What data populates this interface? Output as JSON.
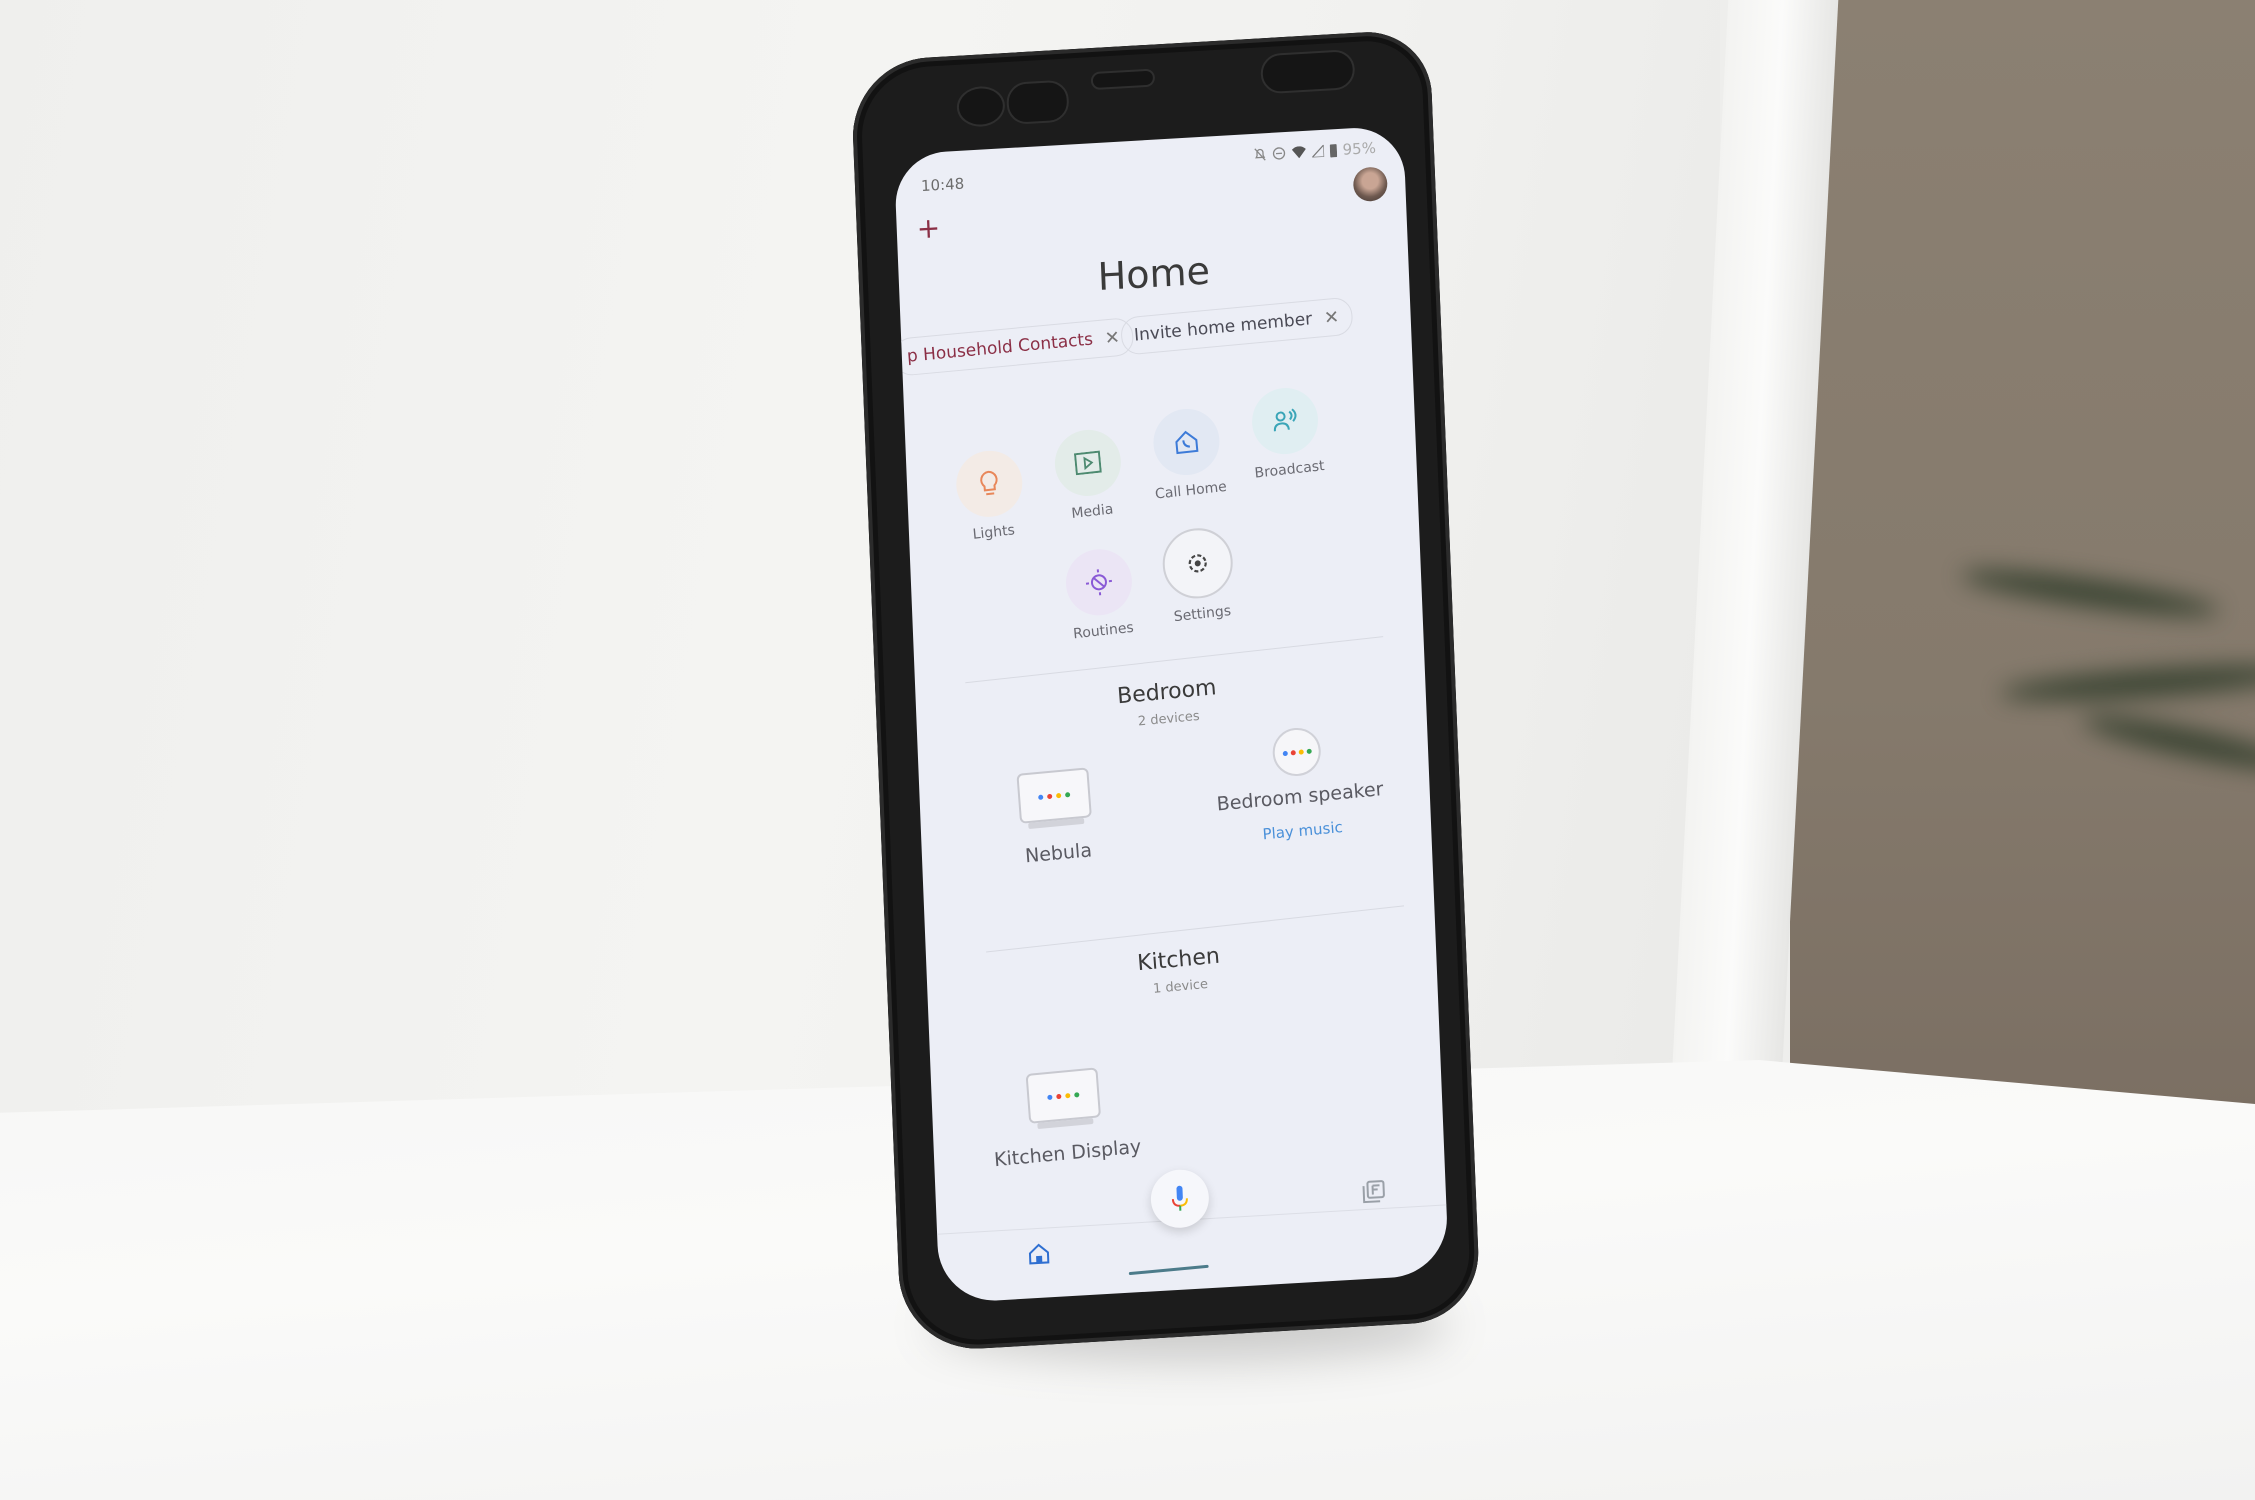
{
  "status_bar": {
    "time": "10:48",
    "icons": [
      "bell-off-icon",
      "do-not-disturb-icon",
      "wifi-icon",
      "signal-icon",
      "battery-icon"
    ],
    "battery": "95%"
  },
  "header": {
    "add_icon": "+",
    "title": "Home"
  },
  "chips": [
    {
      "label": "p Household Contacts",
      "close": "✕"
    },
    {
      "label": "Invite home member",
      "close": "✕"
    }
  ],
  "actions": [
    {
      "label": "Lights",
      "icon": "lightbulb-icon",
      "glyph": "💡",
      "color": "#e8875a",
      "bg": "#f3ebe6"
    },
    {
      "label": "Media",
      "icon": "play-box-icon",
      "glyph": "▷",
      "color": "#4d8a70",
      "bg": "#e3ece9"
    },
    {
      "label": "Call Home",
      "icon": "call-home-icon",
      "glyph": "⌂",
      "color": "#3d7bd8",
      "bg": "#e2e8f3"
    },
    {
      "label": "Broadcast",
      "icon": "broadcast-icon",
      "glyph": "👥",
      "color": "#3aa5b8",
      "bg": "#e0eef2"
    },
    {
      "label": "Routines",
      "icon": "routines-icon",
      "glyph": "☼",
      "color": "#8a5ad6",
      "bg": "#ebe5f5"
    },
    {
      "label": "Settings",
      "icon": "gear-icon",
      "glyph": "⚙",
      "color": "#444444",
      "bg": "#f1f2f6"
    }
  ],
  "rooms": [
    {
      "name": "Bedroom",
      "count": "2 devices",
      "devices": [
        {
          "name": "Nebula",
          "type": "display"
        },
        {
          "name": "Bedroom speaker",
          "type": "speaker",
          "action": "Play music"
        }
      ]
    },
    {
      "name": "Kitchen",
      "count": "1 device",
      "devices": [
        {
          "name": "Kitchen Display",
          "type": "display"
        }
      ]
    }
  ],
  "assistant_dots": [
    "#4285f4",
    "#ea4335",
    "#fbbc05",
    "#34a853"
  ],
  "bottom_nav": {
    "home_icon": "⌂",
    "feed_icon": "❐",
    "mic_icon": "🎙"
  }
}
